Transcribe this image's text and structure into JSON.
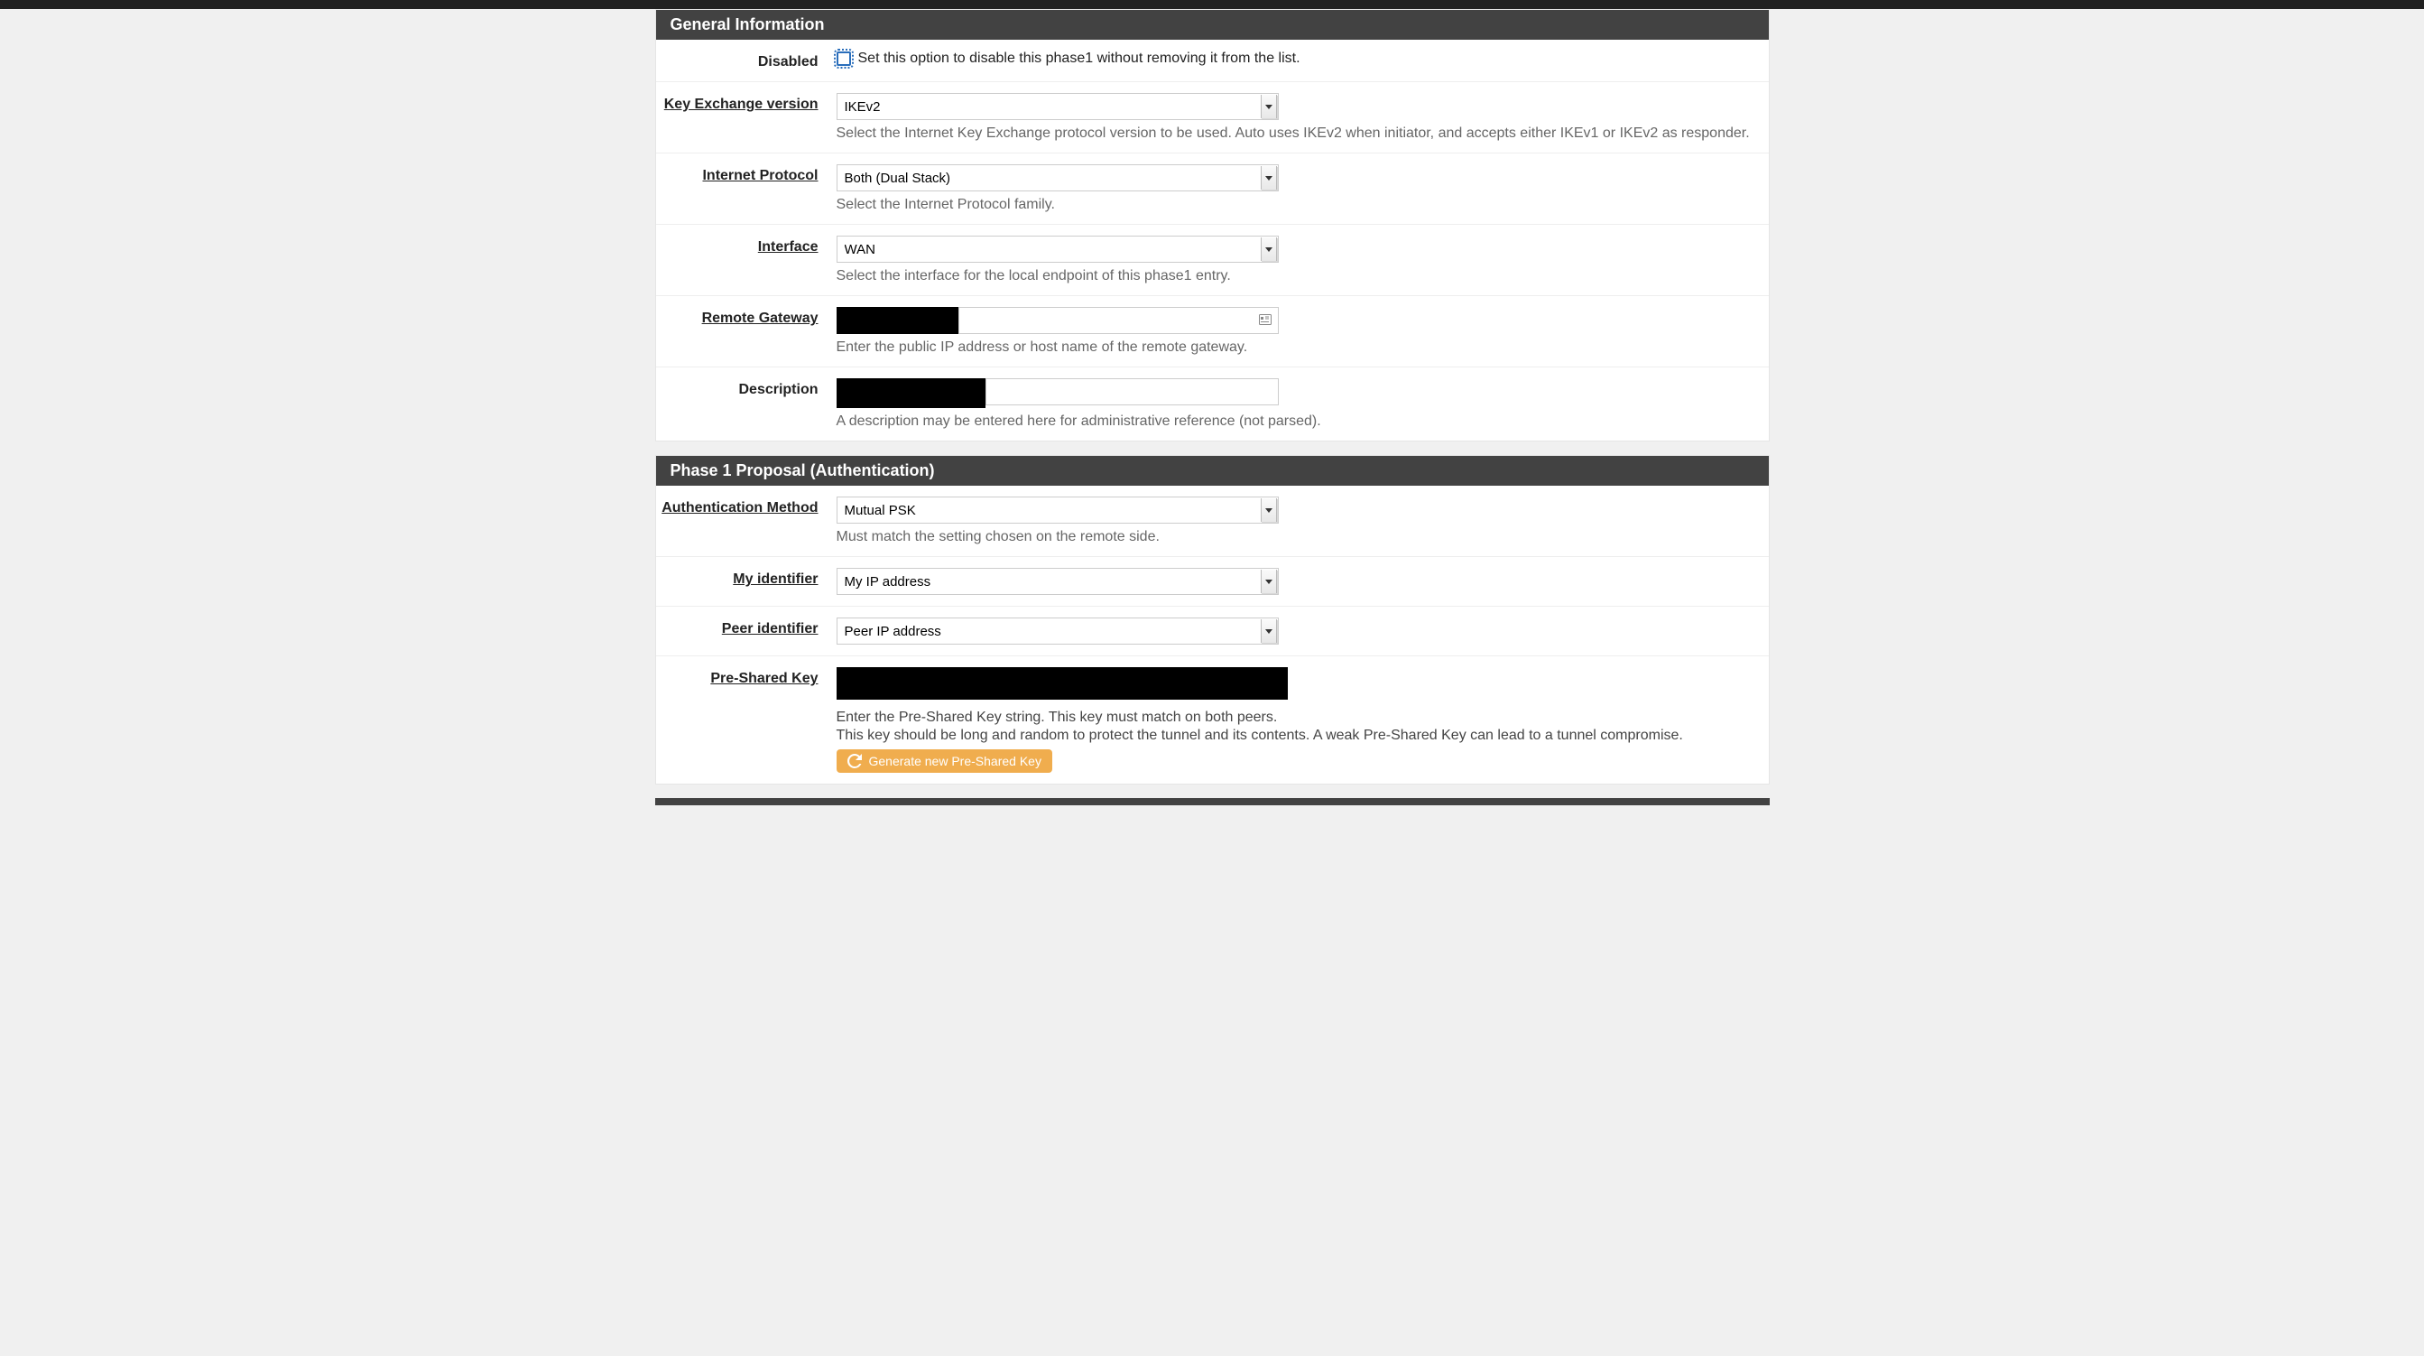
{
  "sections": {
    "general": {
      "title": "General Information",
      "disabled": {
        "label": "Disabled",
        "desc": "Set this option to disable this phase1 without removing it from the list."
      },
      "kev": {
        "label": "Key Exchange version",
        "value": "IKEv2",
        "help": "Select the Internet Key Exchange protocol version to be used. Auto uses IKEv2 when initiator, and accepts either IKEv1 or IKEv2 as responder."
      },
      "ip": {
        "label": "Internet Protocol",
        "value": "Both (Dual Stack)",
        "help": "Select the Internet Protocol family."
      },
      "iface": {
        "label": "Interface",
        "value": "WAN",
        "help": "Select the interface for the local endpoint of this phase1 entry."
      },
      "gateway": {
        "label": "Remote Gateway",
        "help": "Enter the public IP address or host name of the remote gateway."
      },
      "description": {
        "label": "Description",
        "help": "A description may be entered here for administrative reference (not parsed)."
      }
    },
    "p1": {
      "title": "Phase 1 Proposal (Authentication)",
      "auth": {
        "label": "Authentication Method",
        "value": "Mutual PSK",
        "help": "Must match the setting chosen on the remote side."
      },
      "myid": {
        "label": "My identifier",
        "value": "My IP address"
      },
      "peerid": {
        "label": "Peer identifier",
        "value": "Peer IP address"
      },
      "psk": {
        "label": "Pre-Shared Key",
        "help1": "Enter the Pre-Shared Key string. This key must match on both peers.",
        "help2": "This key should be long and random to protect the tunnel and its contents. A weak Pre-Shared Key can lead to a tunnel compromise.",
        "button": "Generate new Pre-Shared Key"
      }
    }
  }
}
